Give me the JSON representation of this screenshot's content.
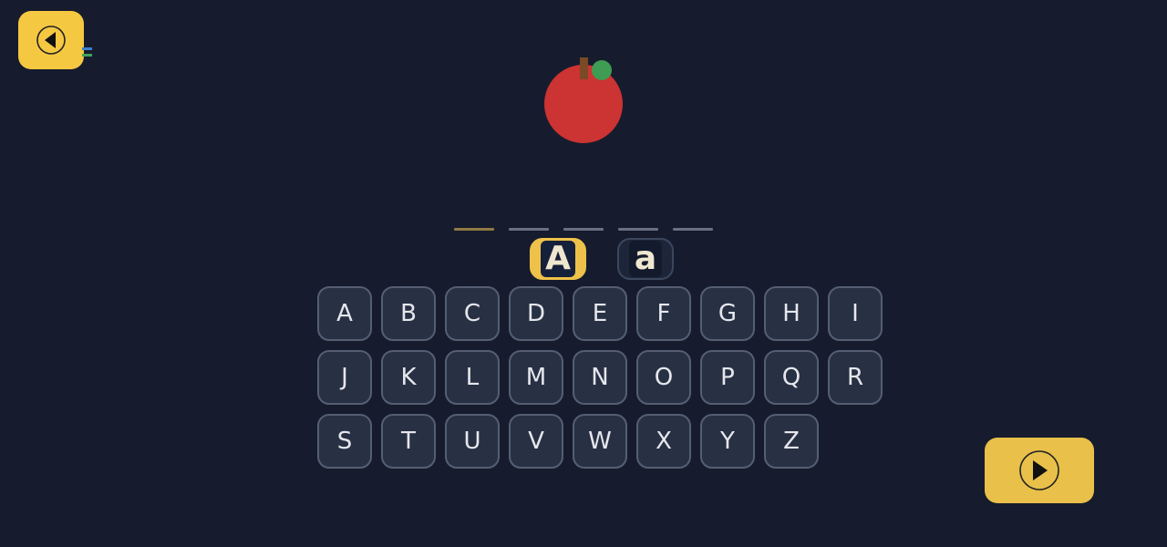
{
  "colors": {
    "background": "#161c2d",
    "accent_yellow": "#f5c842",
    "key_fill": "#283044",
    "key_border": "#555e73",
    "key_text": "#e5e7ec",
    "slot_active": "#8f7a45",
    "slot_idle": "#6b7080",
    "apple_red": "#cc3333",
    "leaf_green": "#3e9c53",
    "stem_brown": "#7a4a24"
  },
  "nav": {
    "back_icon": "circle-triangle-left-icon",
    "next_icon": "circle-triangle-right-icon"
  },
  "picture": {
    "icon": "apple-icon"
  },
  "word": {
    "slot_count": 5,
    "active_slot": 1
  },
  "case_toggle": {
    "upper_label": "A",
    "lower_label": "a",
    "selected": "upper"
  },
  "keyboard": {
    "rows": [
      [
        "A",
        "B",
        "C",
        "D",
        "E",
        "F",
        "G",
        "H",
        "I"
      ],
      [
        "J",
        "K",
        "L",
        "M",
        "N",
        "O",
        "P",
        "Q",
        "R"
      ],
      [
        "S",
        "T",
        "U",
        "V",
        "W",
        "X",
        "Y",
        "Z"
      ]
    ]
  }
}
